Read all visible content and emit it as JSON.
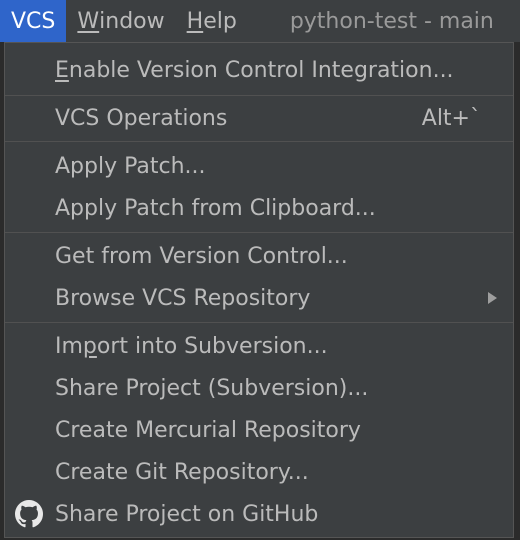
{
  "menubar": {
    "items": [
      {
        "label": "VCS",
        "active": true
      },
      {
        "label": "Window",
        "mnemonic": "W",
        "rest": "indow"
      },
      {
        "label": "Help",
        "mnemonic": "H",
        "rest": "elp"
      }
    ],
    "window_title": "python-test - main"
  },
  "menu": {
    "enable_vcs": {
      "mnemonic": "E",
      "rest": "nable Version Control Integration..."
    },
    "vcs_operations": {
      "label": "VCS Operations",
      "shortcut": "Alt+`"
    },
    "apply_patch": {
      "label": "Apply Patch..."
    },
    "apply_patch_clipboard": {
      "label": "Apply Patch from Clipboard..."
    },
    "get_from_vc": {
      "label": "Get from Version Control..."
    },
    "browse_vcs_repo": {
      "label": "Browse VCS Repository"
    },
    "import_subversion": {
      "pre": "Im",
      "mnemonic": "p",
      "rest": "ort into Subversion..."
    },
    "share_subversion": {
      "label": "Share Project (Subversion)..."
    },
    "create_mercurial": {
      "label": "Create Mercurial Repository"
    },
    "create_git": {
      "label": "Create Git Repository..."
    },
    "share_github": {
      "label": "Share Project on GitHub",
      "icon": "github-icon"
    }
  },
  "colors": {
    "menubar_bg": "#3c3f41",
    "active_bg": "#2f65ca",
    "menu_bg": "#3c3f41",
    "text": "#bbbbbb"
  }
}
